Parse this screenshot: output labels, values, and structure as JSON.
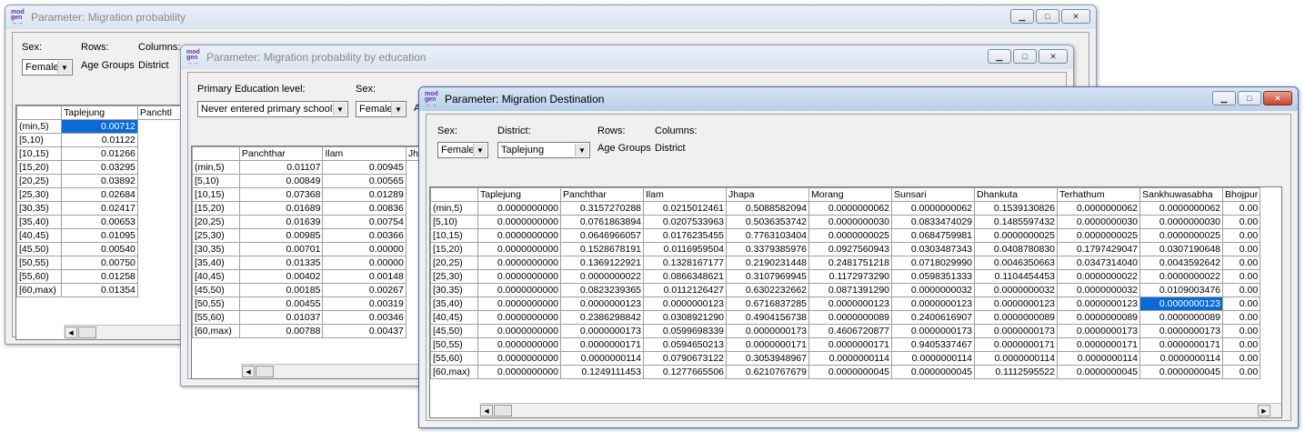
{
  "win1": {
    "title": "Parameter: Migration probability",
    "labels": {
      "sex": "Sex:",
      "rows": "Rows:",
      "columns": "Columns:"
    },
    "sex_value": "Female",
    "rows_value": "Age Groups",
    "columns_value": "District",
    "col_headers": [
      "Taplejung",
      "Panchtl"
    ],
    "rows": [
      [
        "(min,5)",
        "0.00712"
      ],
      [
        "[5,10)",
        "0.01122"
      ],
      [
        "[10,15)",
        "0.01266"
      ],
      [
        "[15,20)",
        "0.03295"
      ],
      [
        "[20,25)",
        "0.03892"
      ],
      [
        "[25,30)",
        "0.02684"
      ],
      [
        "[30,35)",
        "0.02417"
      ],
      [
        "[35,40)",
        "0.00653"
      ],
      [
        "[40,45)",
        "0.01095"
      ],
      [
        "[45,50)",
        "0.00540"
      ],
      [
        "[50,55)",
        "0.00750"
      ],
      [
        "[55,60)",
        "0.01258"
      ],
      [
        "[60,max)",
        "0.01354"
      ]
    ]
  },
  "win2": {
    "title": "Parameter: Migration probability by education",
    "labels": {
      "edu": "Primary Education level:",
      "sex": "Sex:",
      "cut": "A"
    },
    "edu_value": "Never entered primary school",
    "sex_value": "Female",
    "col_headers": [
      "Panchthar",
      "Ilam",
      "Jh"
    ],
    "rows": [
      [
        "(min,5)",
        "0.01107",
        "0.00945"
      ],
      [
        "[5,10)",
        "0.00849",
        "0.00565"
      ],
      [
        "[10,15)",
        "0.07368",
        "0.01289"
      ],
      [
        "[15,20)",
        "0.01689",
        "0.00836"
      ],
      [
        "[20,25)",
        "0.01639",
        "0.00754"
      ],
      [
        "[25,30)",
        "0.00985",
        "0.00366"
      ],
      [
        "[30,35)",
        "0.00701",
        "0.00000"
      ],
      [
        "[35,40)",
        "0.01335",
        "0.00000"
      ],
      [
        "[40,45)",
        "0.00402",
        "0.00148"
      ],
      [
        "[45,50)",
        "0.00185",
        "0.00267"
      ],
      [
        "[50,55)",
        "0.00455",
        "0.00319"
      ],
      [
        "[55,60)",
        "0.01037",
        "0.00346"
      ],
      [
        "[60,max)",
        "0.00788",
        "0.00437"
      ]
    ]
  },
  "win3": {
    "title": "Parameter: Migration Destination",
    "labels": {
      "sex": "Sex:",
      "district": "District:",
      "rows": "Rows:",
      "columns": "Columns:"
    },
    "sex_value": "Female",
    "district_value": "Taplejung",
    "rows_value": "Age Groups",
    "columns_value": "District",
    "col_headers": [
      "Taplejung",
      "Panchthar",
      "Ilam",
      "Jhapa",
      "Morang",
      "Sunsari",
      "Dhankuta",
      "Terhathum",
      "Sankhuwasabha",
      "Bhojpur"
    ],
    "rows": [
      [
        "(min,5)",
        "0.0000000000",
        "0.3157270288",
        "0.0215012461",
        "0.5088582094",
        "0.0000000062",
        "0.0000000062",
        "0.1539130826",
        "0.0000000062",
        "0.0000000062",
        "0.00"
      ],
      [
        "[5,10)",
        "0.0000000000",
        "0.0761863894",
        "0.0207533963",
        "0.5036353742",
        "0.0000000030",
        "0.0833474029",
        "0.1485597432",
        "0.0000000030",
        "0.0000000030",
        "0.00"
      ],
      [
        "[10,15)",
        "0.0000000000",
        "0.0646966057",
        "0.0176235455",
        "0.7763103404",
        "0.0000000025",
        "0.0684759981",
        "0.0000000025",
        "0.0000000025",
        "0.0000000025",
        "0.00"
      ],
      [
        "[15,20)",
        "0.0000000000",
        "0.1528678191",
        "0.0116959504",
        "0.3379385976",
        "0.0927560943",
        "0.0303487343",
        "0.0408780830",
        "0.1797429047",
        "0.0307190648",
        "0.00"
      ],
      [
        "[20,25)",
        "0.0000000000",
        "0.1369122921",
        "0.1328167177",
        "0.2190231448",
        "0.2481751218",
        "0.0718029990",
        "0.0046350663",
        "0.0347314040",
        "0.0043592642",
        "0.00"
      ],
      [
        "[25,30)",
        "0.0000000000",
        "0.0000000022",
        "0.0866348621",
        "0.3107969945",
        "0.1172973290",
        "0.0598351333",
        "0.1104454453",
        "0.0000000022",
        "0.0000000022",
        "0.00"
      ],
      [
        "[30,35)",
        "0.0000000000",
        "0.0823239365",
        "0.0112126427",
        "0.6302232662",
        "0.0871391290",
        "0.0000000032",
        "0.0000000032",
        "0.0000000032",
        "0.0109003476",
        "0.00"
      ],
      [
        "[35,40)",
        "0.0000000000",
        "0.0000000123",
        "0.0000000123",
        "0.6716837285",
        "0.0000000123",
        "0.0000000123",
        "0.0000000123",
        "0.0000000123",
        "0.0000000123",
        "0.00"
      ],
      [
        "[40,45)",
        "0.0000000000",
        "0.2386298842",
        "0.0308921290",
        "0.4904156738",
        "0.0000000089",
        "0.2400616907",
        "0.0000000089",
        "0.0000000089",
        "0.0000000089",
        "0.00"
      ],
      [
        "[45,50)",
        "0.0000000000",
        "0.0000000173",
        "0.0599698339",
        "0.0000000173",
        "0.4606720877",
        "0.0000000173",
        "0.0000000173",
        "0.0000000173",
        "0.0000000173",
        "0.00"
      ],
      [
        "[50,55)",
        "0.0000000000",
        "0.0000000171",
        "0.0594650213",
        "0.0000000171",
        "0.0000000171",
        "0.9405337467",
        "0.0000000171",
        "0.0000000171",
        "0.0000000171",
        "0.00"
      ],
      [
        "[55,60)",
        "0.0000000000",
        "0.0000000114",
        "0.0790673122",
        "0.3053948967",
        "0.0000000114",
        "0.0000000114",
        "0.0000000114",
        "0.0000000114",
        "0.0000000114",
        "0.00"
      ],
      [
        "[60,max)",
        "0.0000000000",
        "0.1249111453",
        "0.1277665506",
        "0.6210767679",
        "0.0000000045",
        "0.0000000045",
        "0.1112595522",
        "0.0000000045",
        "0.0000000045",
        "0.00"
      ]
    ]
  }
}
